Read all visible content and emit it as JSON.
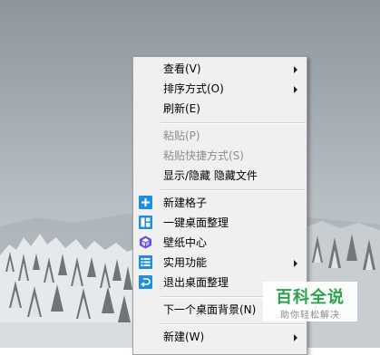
{
  "context_menu": {
    "items": [
      {
        "label": "查看(V)",
        "has_submenu": true
      },
      {
        "label": "排序方式(O)",
        "has_submenu": true
      },
      {
        "label": "刷新(E)"
      },
      {
        "label": "粘贴(P)",
        "disabled": true
      },
      {
        "label": "粘贴快捷方式(S)",
        "disabled": true
      },
      {
        "label": "显示/隐藏 隐藏文件"
      },
      {
        "label": "新建格子",
        "icon": "plus-box-icon"
      },
      {
        "label": "一键桌面整理",
        "icon": "layout-grid-icon"
      },
      {
        "label": "壁纸中心",
        "icon": "cube-icon"
      },
      {
        "label": "实用功能",
        "icon": "list-icon",
        "has_submenu": true
      },
      {
        "label": "退出桌面整理",
        "icon": "exit-icon"
      },
      {
        "label": "下一个桌面背景(N)"
      },
      {
        "label": "新建(W)",
        "has_submenu": true
      }
    ],
    "icon_color": "#1e8fe0"
  },
  "watermark": {
    "title": "百科全说",
    "subtitle": "助你轻松解决",
    "title_color": "#2ba24c"
  }
}
